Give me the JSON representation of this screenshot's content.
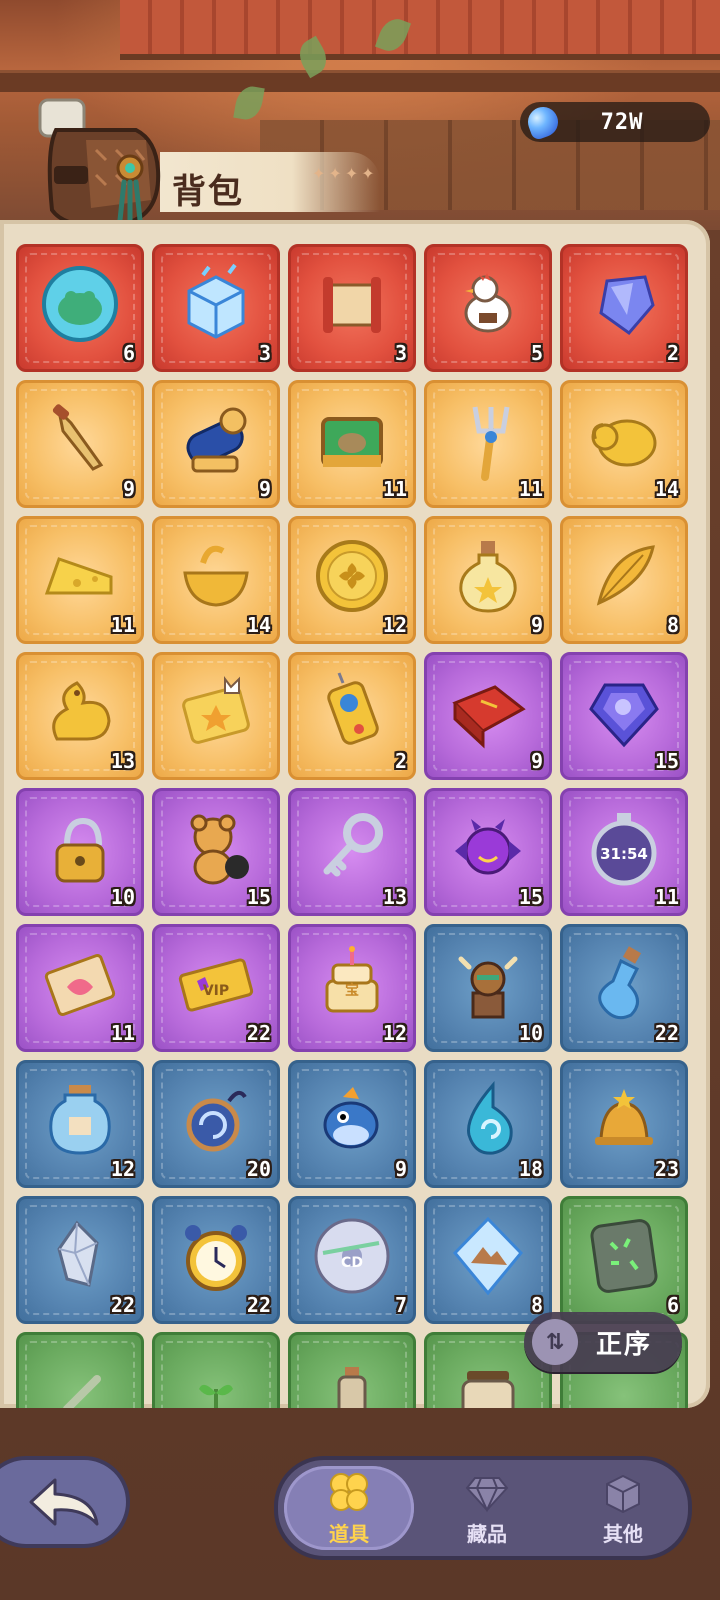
{
  "header": {
    "title": "背包",
    "currency": {
      "icon": "blue-gem-icon",
      "value": "72W"
    }
  },
  "items": [
    {
      "name": "frog-orb-icon",
      "rarity": "red",
      "count": "6"
    },
    {
      "name": "ice-cube-icon",
      "rarity": "red",
      "count": "3"
    },
    {
      "name": "scroll-icon",
      "rarity": "red",
      "count": "3"
    },
    {
      "name": "rooster-icon",
      "rarity": "red",
      "count": "5"
    },
    {
      "name": "blue-crystal-icon",
      "rarity": "red",
      "count": "2"
    },
    {
      "name": "dagger-icon",
      "rarity": "gold",
      "count": "9"
    },
    {
      "name": "cannon-icon",
      "rarity": "gold",
      "count": "9"
    },
    {
      "name": "treasure-box-icon",
      "rarity": "gold",
      "count": "11"
    },
    {
      "name": "trident-fork-icon",
      "rarity": "gold",
      "count": "11"
    },
    {
      "name": "golden-sheep-icon",
      "rarity": "gold",
      "count": "14"
    },
    {
      "name": "cheese-icon",
      "rarity": "gold",
      "count": "11"
    },
    {
      "name": "golden-bowl-icon",
      "rarity": "gold",
      "count": "14"
    },
    {
      "name": "clover-coin-icon",
      "rarity": "gold",
      "count": "12"
    },
    {
      "name": "potion-bottle-icon",
      "rarity": "gold",
      "count": "9"
    },
    {
      "name": "golden-feather-icon",
      "rarity": "gold",
      "count": "8"
    },
    {
      "name": "golden-dragon-icon",
      "rarity": "gold",
      "count": "13"
    },
    {
      "name": "cat-ticket-icon",
      "rarity": "gold",
      "count": ""
    },
    {
      "name": "remote-device-icon",
      "rarity": "gold",
      "count": "2"
    },
    {
      "name": "red-book-icon",
      "rarity": "purple",
      "count": "9"
    },
    {
      "name": "purple-gem-icon",
      "rarity": "purple",
      "count": "15"
    },
    {
      "name": "padlock-chain-icon",
      "rarity": "purple",
      "count": "10"
    },
    {
      "name": "teddy-bear-icon",
      "rarity": "purple",
      "count": "15"
    },
    {
      "name": "silver-key-icon",
      "rarity": "purple",
      "count": "13"
    },
    {
      "name": "devil-candy-icon",
      "rarity": "purple",
      "count": "15"
    },
    {
      "name": "stopwatch-icon",
      "rarity": "purple",
      "count": "11",
      "label": "31:54"
    },
    {
      "name": "gift-letter-icon",
      "rarity": "purple",
      "count": "11"
    },
    {
      "name": "vip-ticket-icon",
      "rarity": "purple",
      "count": "22",
      "label": "VIP"
    },
    {
      "name": "birthday-cake-icon",
      "rarity": "purple",
      "count": "12",
      "label": "宝"
    },
    {
      "name": "ox-totem-icon",
      "rarity": "blue",
      "count": "10"
    },
    {
      "name": "water-bottle-icon",
      "rarity": "blue",
      "count": "22"
    },
    {
      "name": "jar-bottle-icon",
      "rarity": "blue",
      "count": "12"
    },
    {
      "name": "swirl-pendant-icon",
      "rarity": "blue",
      "count": "20"
    },
    {
      "name": "puffer-fish-icon",
      "rarity": "blue",
      "count": "9"
    },
    {
      "name": "water-drop-icon",
      "rarity": "blue",
      "count": "18"
    },
    {
      "name": "golden-bell-icon",
      "rarity": "blue",
      "count": "23"
    },
    {
      "name": "crystal-shard-icon",
      "rarity": "blue",
      "count": "22"
    },
    {
      "name": "alarm-clock-icon",
      "rarity": "blue",
      "count": "22"
    },
    {
      "name": "cd-disc-icon",
      "rarity": "blue",
      "count": "7",
      "label": "CD"
    },
    {
      "name": "ice-mountain-icon",
      "rarity": "blue",
      "count": "8"
    },
    {
      "name": "rune-stone-icon",
      "rarity": "green",
      "count": "6"
    },
    {
      "name": "partial-item-icon",
      "rarity": "green",
      "count": ""
    },
    {
      "name": "sprout-icon",
      "rarity": "green",
      "count": ""
    },
    {
      "name": "small-bottle-icon",
      "rarity": "green",
      "count": ""
    },
    {
      "name": "jar-icon",
      "rarity": "green",
      "count": ""
    },
    {
      "name": "hidden-item-icon",
      "rarity": "green",
      "count": ""
    }
  ],
  "sort_button": {
    "label": "正序",
    "icon": "swap-arrows-icon"
  },
  "bottom_nav": {
    "back_icon": "back-arrow-icon",
    "tabs": [
      {
        "label": "道具",
        "icon": "clover-icon",
        "active": true
      },
      {
        "label": "藏品",
        "icon": "diamond-icon",
        "active": false
      },
      {
        "label": "其他",
        "icon": "box-icon",
        "active": false
      }
    ]
  },
  "colors": {
    "red": "#e2513f",
    "gold": "#f7bf66",
    "purple": "#b76ada",
    "blue": "#5583b0",
    "green": "#6aaa5f",
    "accent": "#ffd34d"
  }
}
